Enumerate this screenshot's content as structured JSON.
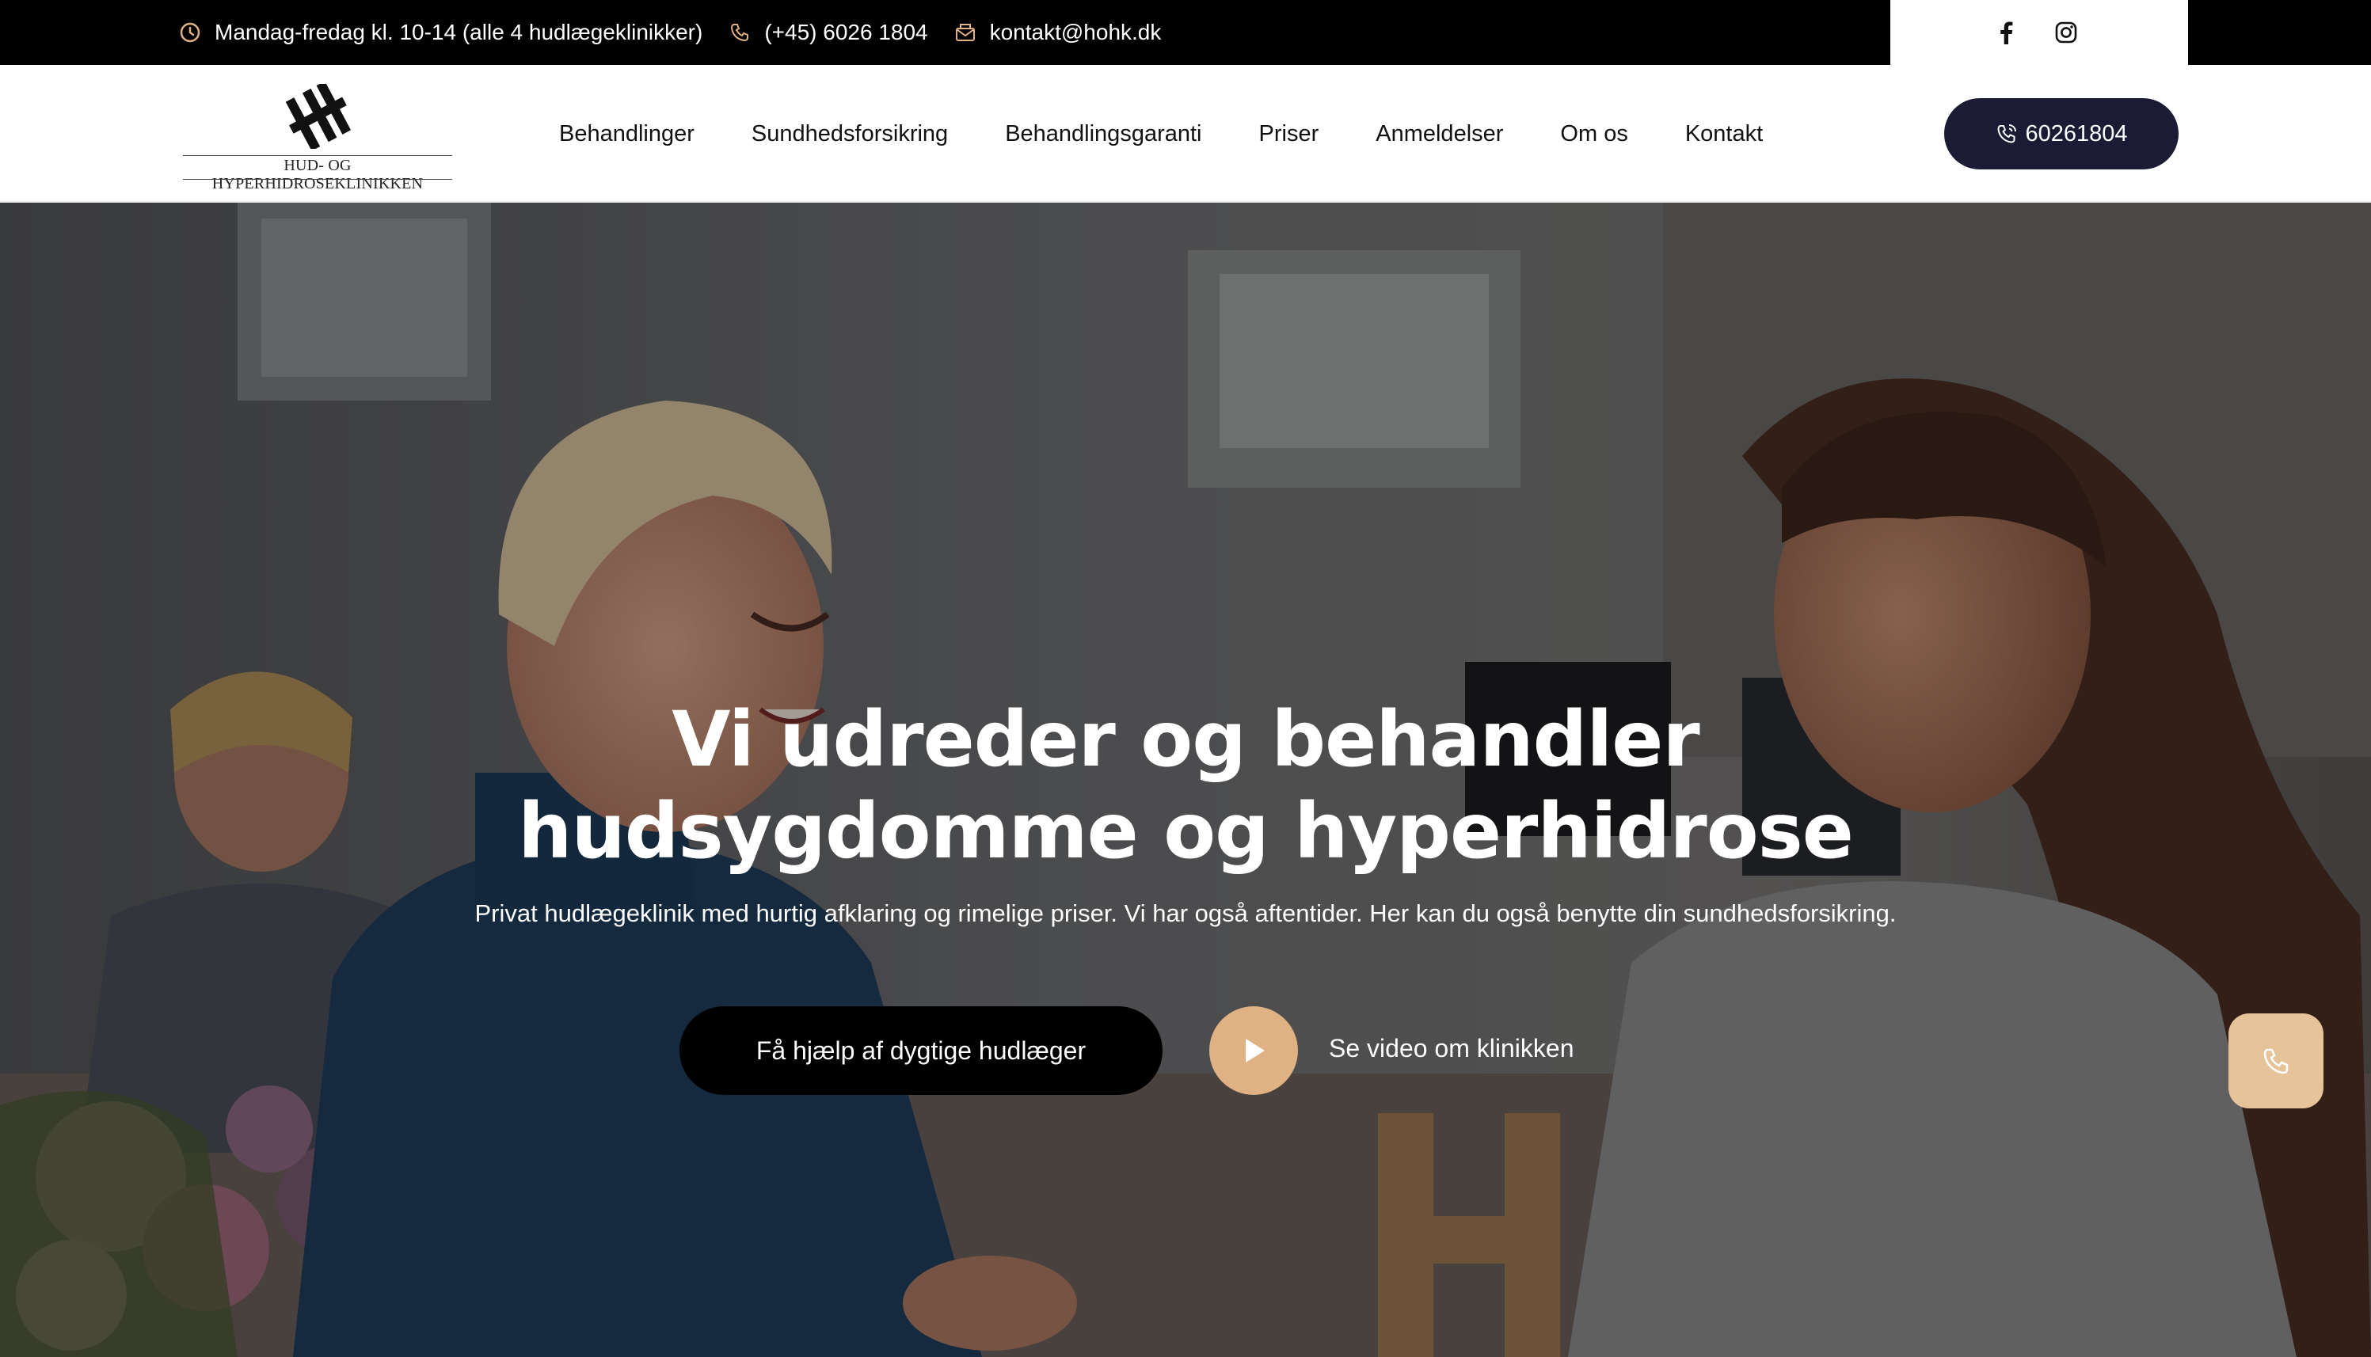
{
  "topbar": {
    "hours": "Mandag-fredag kl. 10-14 (alle 4 hudlægeklinikker)",
    "phone": "(+45) 6026 1804",
    "email": "kontakt@hohk.dk",
    "hours_icon": "clock-icon",
    "phone_icon": "phone-icon",
    "email_icon": "envelope-icon",
    "social_icons": [
      "facebook-icon",
      "instagram-icon"
    ]
  },
  "header": {
    "logo_text": "HUD- OG HYPERHIDROSEKLINIKKEN",
    "nav": [
      "Behandlinger",
      "Sundhedsforsikring",
      "Behandlingsgaranti",
      "Priser",
      "Anmeldelser",
      "Om os",
      "Kontakt"
    ],
    "phone_button": "60261804"
  },
  "hero": {
    "title_line1": "Vi udreder og behandler",
    "title_line2": "hudsygdomme og hyperhidrose",
    "subtitle": "Privat hudlægeklinik med hurtig afklaring og rimelige priser. Vi har også aftentider. Her kan du også benytte din sundhedsforsikring.",
    "cta": "Få hjælp af dygtige hudlæger",
    "video_label": "Se video om klinikken"
  },
  "colors": {
    "topbar_bg": "#000000",
    "accent_tan": "#dfb183",
    "phone_button_bg": "#1b1b35",
    "cta_bg": "#000000"
  }
}
